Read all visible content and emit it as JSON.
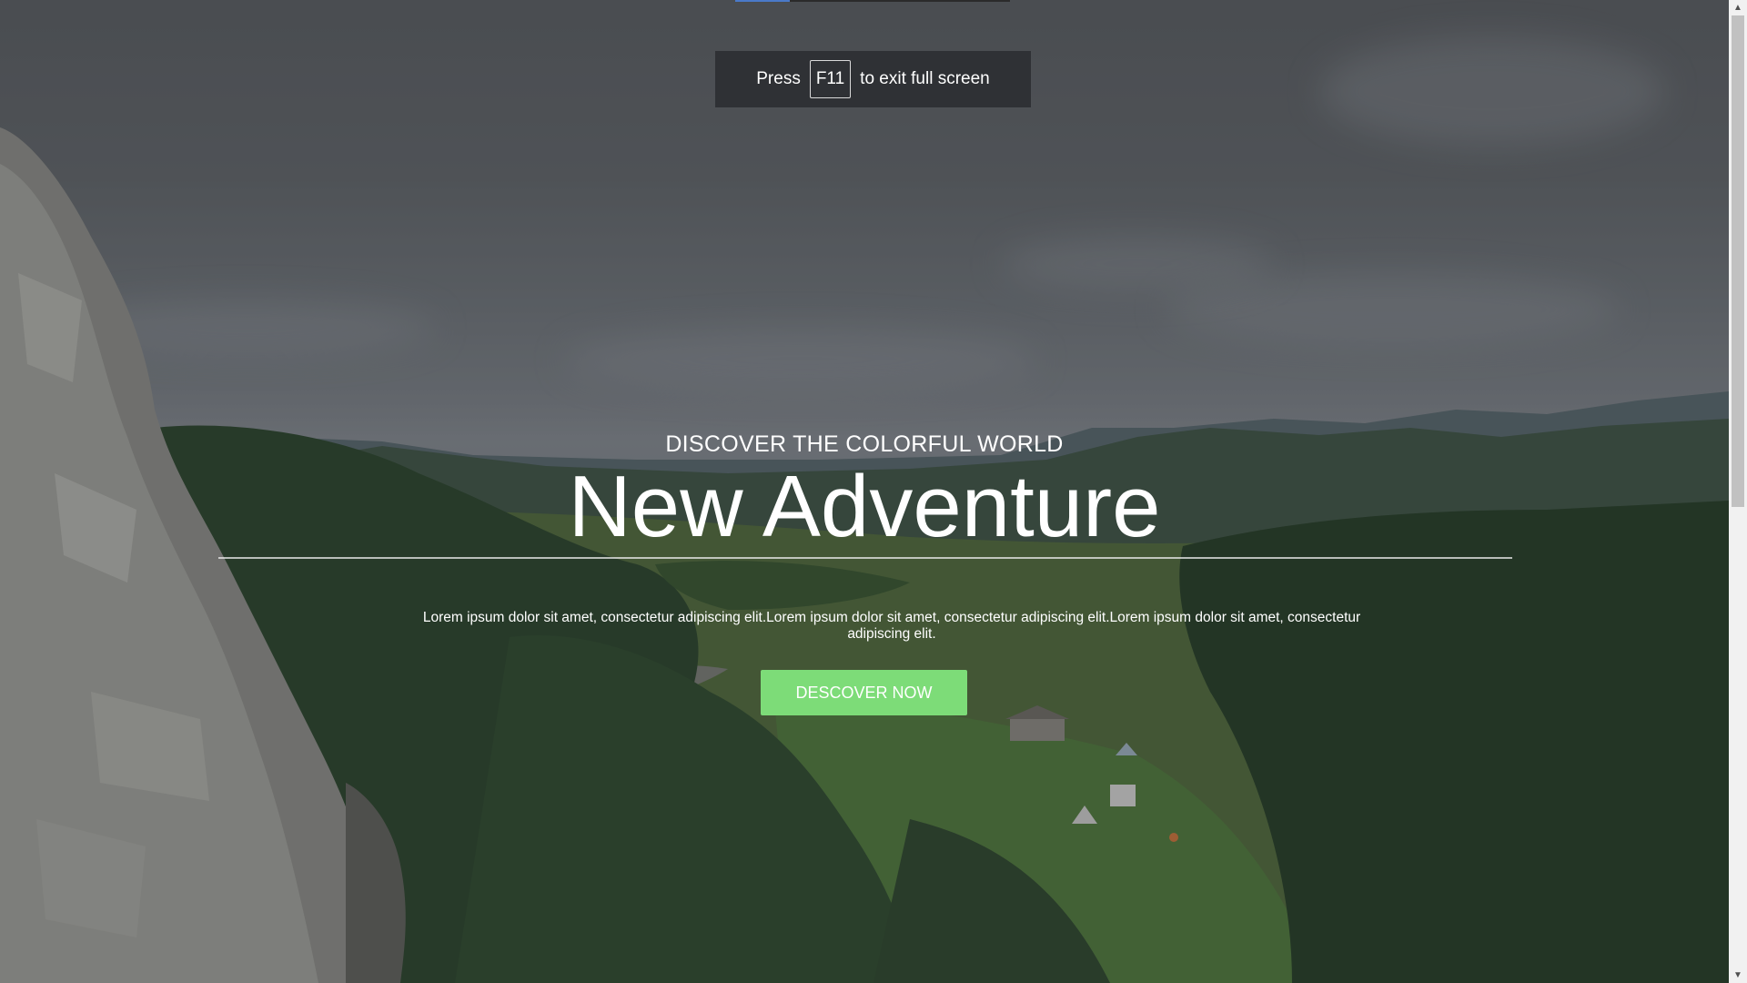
{
  "fullscreen_notice": {
    "before": "Press",
    "key": "F11",
    "after": "to exit full screen"
  },
  "hero": {
    "kicker": "DISCOVER THE COLORFUL WORLD",
    "title": "New Adventure",
    "body": "Lorem ipsum dolor sit amet, consectetur adipiscing elit.Lorem ipsum dolor sit amet, consectetur adipiscing elit.Lorem ipsum dolor sit amet, consectetur adipiscing elit.",
    "button_label": "DESCOVER NOW"
  },
  "colors": {
    "button": "#7ddc78",
    "overlay": "#282828",
    "toast": "#2f3135"
  },
  "icons": {
    "scroll_up": "chevron-up-icon",
    "scroll_down": "chevron-down-icon"
  }
}
